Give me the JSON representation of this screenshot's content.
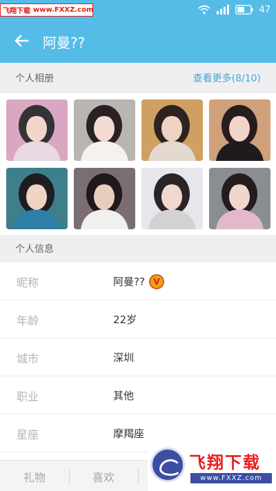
{
  "status_bar": {
    "watermark_name": "飞翔下载",
    "watermark_url": "www.FXXZ.com",
    "battery": "47"
  },
  "header": {
    "title": "阿曼??"
  },
  "album": {
    "title": "个人相册",
    "more_label": "查看更多(8/10)",
    "photos": [
      {
        "bg": "#d9a7c2",
        "top": "#333335",
        "face": "#f2d6cc",
        "body": "#e9d9e3"
      },
      {
        "bg": "#b9b5b3",
        "top": "#2a2222",
        "face": "#f3dad3",
        "body": "#f5f1ee"
      },
      {
        "bg": "#cfa061",
        "top": "#2d2320",
        "face": "#f0d2c2",
        "body": "#e3d9d0"
      },
      {
        "bg": "#cfa07a",
        "top": "#261d1d",
        "face": "#f2d5c9",
        "body": "#1d1b1d"
      },
      {
        "bg": "#3f7f8c",
        "top": "#1d1d22",
        "face": "#efd3c3",
        "body": "#2e7fa6"
      },
      {
        "bg": "#7a6e72",
        "top": "#20181a",
        "face": "#e8cdbd",
        "body": "#f2f0ee"
      },
      {
        "bg": "#e7e6ea",
        "top": "#2b2426",
        "face": "#f0d8cc",
        "body": "#d3d1d4"
      },
      {
        "bg": "#8a8e92",
        "top": "#231d1f",
        "face": "#f1d6cb",
        "body": "#e4b8cb"
      }
    ]
  },
  "info": {
    "title": "个人信息",
    "rows": [
      {
        "label": "昵称",
        "value": "阿曼??",
        "badge": "V"
      },
      {
        "label": "年龄",
        "value": "22岁"
      },
      {
        "label": "城市",
        "value": "深圳"
      },
      {
        "label": "职业",
        "value": "其他"
      },
      {
        "label": "星座",
        "value": "摩羯座"
      }
    ]
  },
  "bottom_bar": {
    "gift_label": "礼物",
    "like_label": "喜欢"
  },
  "watermark_logo": {
    "brand": "飞翔下载",
    "site": "www.FXXZ.com"
  },
  "colors": {
    "accent": "#55bce8",
    "link": "#42a7d8",
    "vip_gold": "#f0a01a"
  }
}
